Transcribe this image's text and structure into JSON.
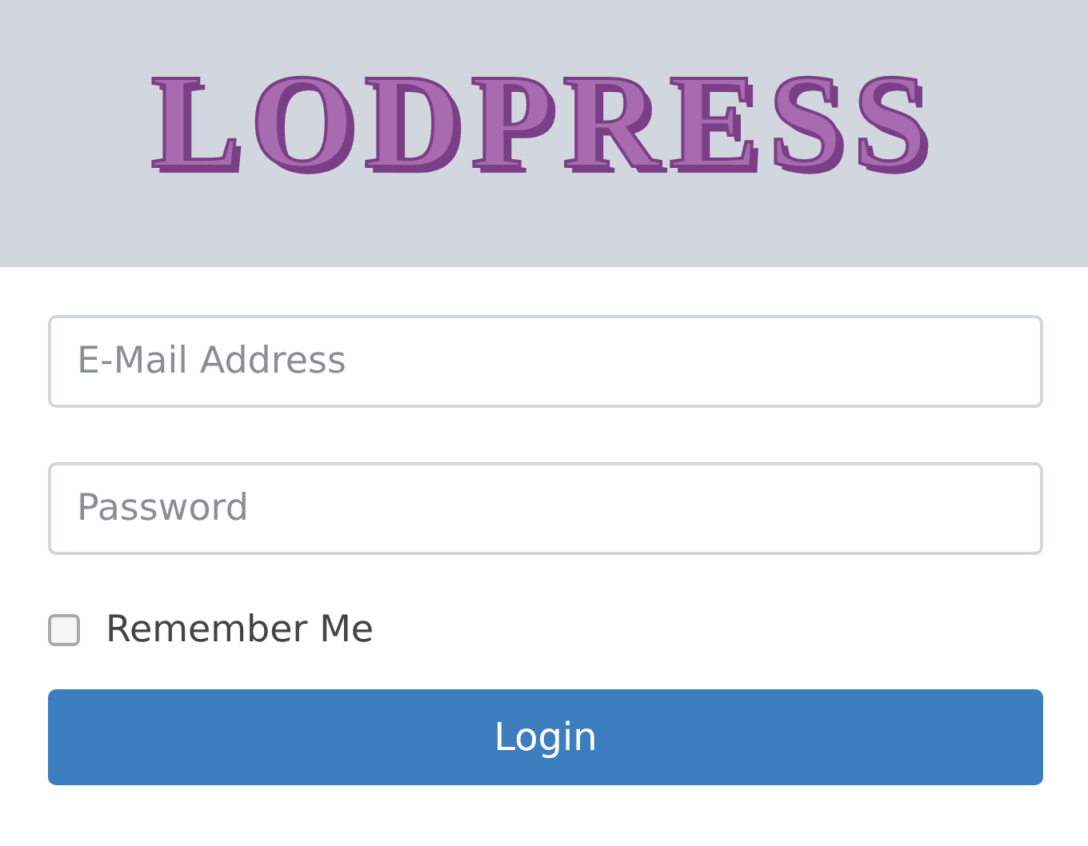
{
  "logo": {
    "text": "LODPRESS"
  },
  "fields": [
    {
      "placeholder": "E-Mail Address"
    },
    {
      "placeholder": "Password"
    }
  ],
  "remember": {
    "label": "Remember Me",
    "checked": false
  },
  "login_button": {
    "label": "Login"
  }
}
